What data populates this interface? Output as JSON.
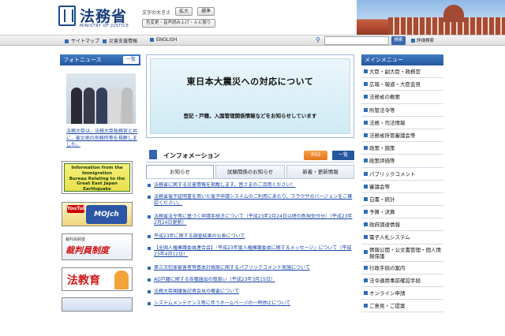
{
  "header": {
    "logo_title": "法務省",
    "logo_sub": "MINISTRY OF JUSTICE",
    "fontsize_label": "文字の大きさ",
    "enlarge_label": "拡大",
    "standard_label": "標準",
    "voice_label": "色変更・音声読み上げ・ルビ振り"
  },
  "nav": {
    "sitemap": "サイトマップ",
    "disaster": "災害支援情報",
    "english": "ENGLISH",
    "search_icon": "search-icon",
    "search_placeholder": "",
    "search_button": "検索",
    "detail_search": "詳細検索"
  },
  "left": {
    "photo_news_title": "フォトニュース",
    "photo_news_list": "一覧",
    "photo_caption": "法務大臣は，法務大臣政務官と共に，被災地の刑務所等を視察しました。",
    "banner_immigration": [
      "Information from the Immigration",
      "Bureau Relating to the",
      "Great East Japan Earthquake"
    ],
    "banner_youtube_yt": "YouTube",
    "banner_youtube_moj": "MOJch",
    "banner_lay_judge_small": "裁判員制度",
    "banner_lay_judge_big": "裁判員制度",
    "banner_law_edu": "法教育"
  },
  "center": {
    "quake_title": "東日本大震災への対応について",
    "quake_desc": "登記・戸籍，入国管理関係情報などをお知らせしています",
    "info_title": "インフォメーション",
    "rss_label": "RSS",
    "list_label": "一覧",
    "tabs": [
      "お知らせ",
      "試験関係のお知らせ",
      "新着・更新情報"
    ],
    "news": [
      "法務省に関する災害情報を掲載します。皆さまのご活用ください！",
      "法務省電子証明書を用いた電子申請システムのご利用にあたり，ブラウザのバージョンをご確認ください。",
      "法務省法令等に基づく申請手続きについて（平成23年2月24日以降の新規受付分）（平成23年2月24日更新）",
      "平成23年に関する調査結果の公表について",
      "【全国人権擁護委員連合会】「平成23年度人権擁護委員に関するメッセージ」について（平成23年4月12日）",
      "第三次犯罪被害者等基本計画案に関するパブリックコメント実施について",
      "AD戸籍に関する各種届出の取扱い（平成23年3月15日）",
      "法務大臣閣議後記者会見の概要について",
      "システムメンテナンス等に伴うホームページの一時停止について"
    ]
  },
  "right": {
    "menu_title": "メインメニュー",
    "items": [
      "大臣・副大臣・政務官",
      "広報・報道・大臣会見",
      "法務省の概要",
      "所管法令等",
      "法務・司法情報",
      "法務省所管審議会等",
      "政策・施策",
      "政策評価等",
      "パブリックコメント",
      "審議会等",
      "白書・統計",
      "予算・決算",
      "政府調達情報",
      "電子入札システム",
      "情報公開・公文書管理・個人情報保護",
      "行政手続の案内",
      "法令適用事前確認手続",
      "オンライン申請",
      "ご意見・ご提案"
    ]
  },
  "colors": {
    "brand_blue": "#24579e",
    "link_blue": "#1a46a8",
    "quake_bg": "#cfeaf4",
    "rss_orange": "#e5761a"
  }
}
